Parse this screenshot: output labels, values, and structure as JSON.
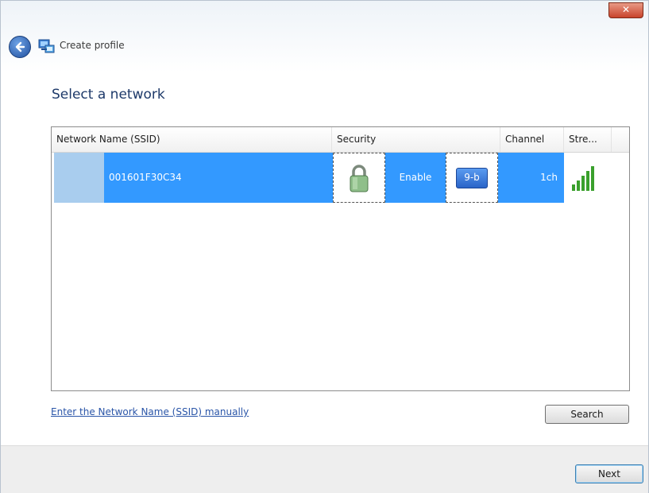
{
  "window": {
    "close_label": "✕",
    "title": "Create profile"
  },
  "page": {
    "heading": "Select a network"
  },
  "network_list": {
    "columns": [
      "Network Name (SSID)",
      "Security",
      "Channel",
      "Stre..."
    ],
    "rows": [
      {
        "ssid": "001601F30C34",
        "security_mode": "Enable",
        "radio_mode": "9-b",
        "channel": "1ch",
        "signal_bars": 5
      }
    ]
  },
  "links": {
    "manual_entry": "Enter the Network Name (SSID) manually"
  },
  "buttons": {
    "search": "Search",
    "next": "Next"
  },
  "colors": {
    "selection": "#3399ff",
    "selection_light": "#a9cdee",
    "signal": "#3aa02c",
    "link": "#2a55a8"
  },
  "icons": {
    "back": "back-arrow-icon",
    "app": "network-profile-icon",
    "security": "padlock-icon",
    "signal": "signal-strength-icon"
  }
}
